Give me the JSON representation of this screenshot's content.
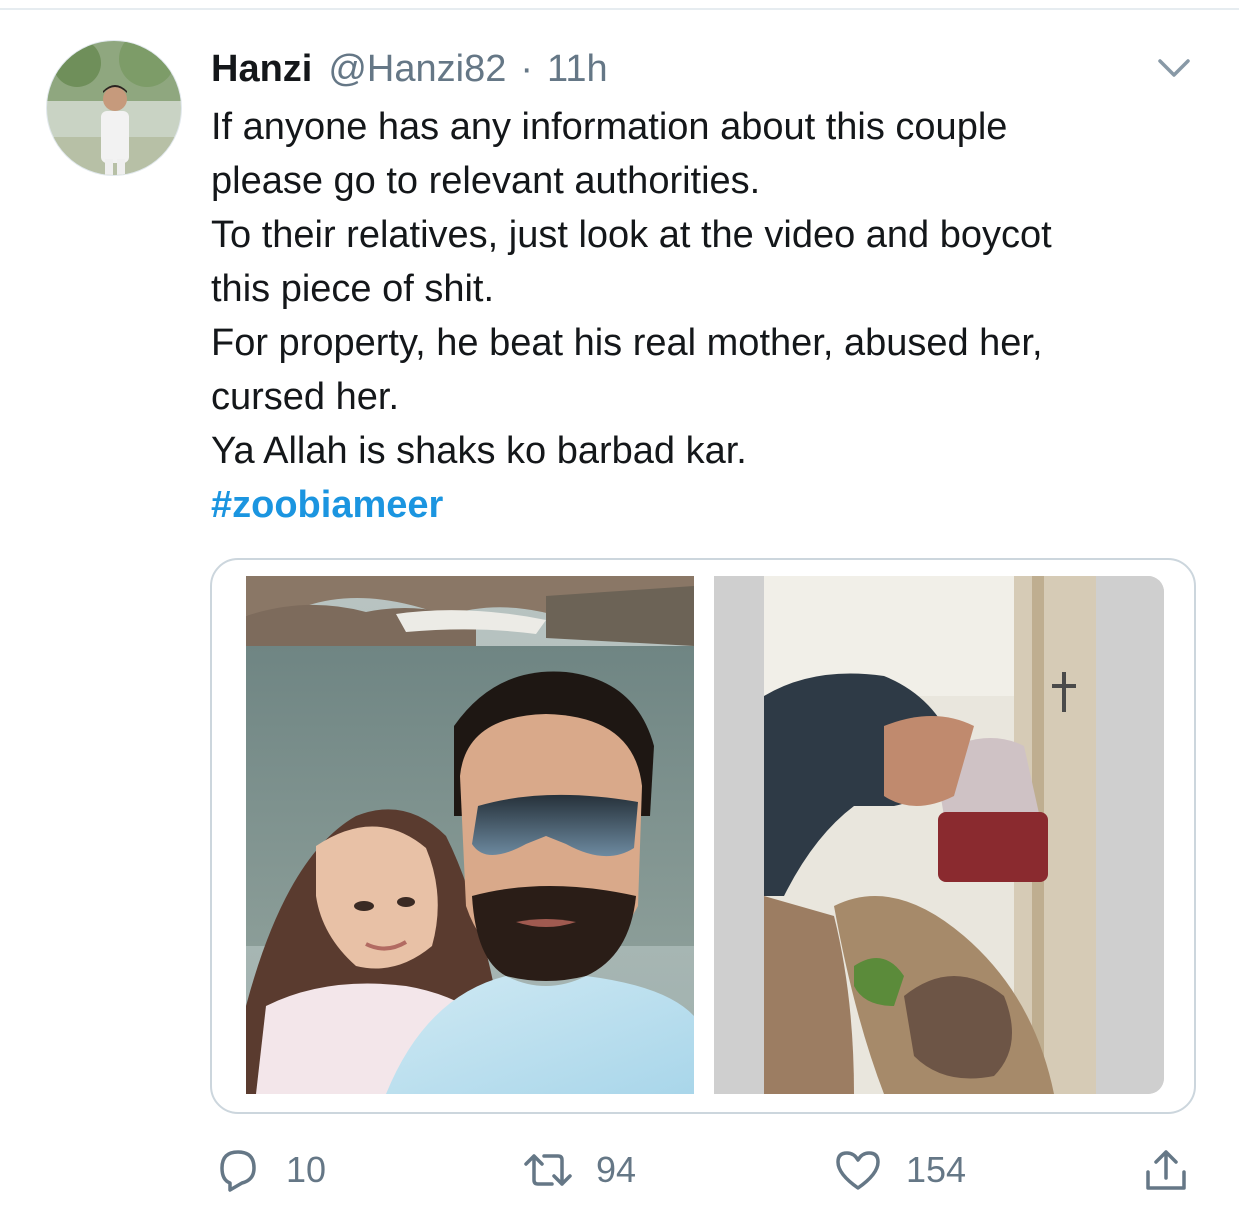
{
  "tweet": {
    "author": {
      "display_name": "Hanzi",
      "handle": "@Hanzi82",
      "separator": "·",
      "time": "11h"
    },
    "text_lines": [
      "If anyone has any information about this couple",
      "please go to relevant authorities.",
      "To their relatives, just look at the video and boycot",
      "this piece of shit.",
      "For property, he beat his real mother, abused her,",
      "cursed her.",
      "Ya Allah is shaks ko barbad kar."
    ],
    "hashtag": "#zoobiameer",
    "media": [
      {
        "icon": "couple-selfie-photo"
      },
      {
        "icon": "video-still-photo"
      }
    ],
    "actions": {
      "reply": {
        "icon": "reply-icon",
        "count": "10"
      },
      "retweet": {
        "icon": "retweet-icon",
        "count": "94"
      },
      "like": {
        "icon": "heart-icon",
        "count": "154"
      },
      "share": {
        "icon": "share-icon"
      }
    }
  },
  "colors": {
    "text": "#14171a",
    "secondary": "#657786",
    "link": "#1b95e0",
    "border": "#ccd6dd"
  }
}
